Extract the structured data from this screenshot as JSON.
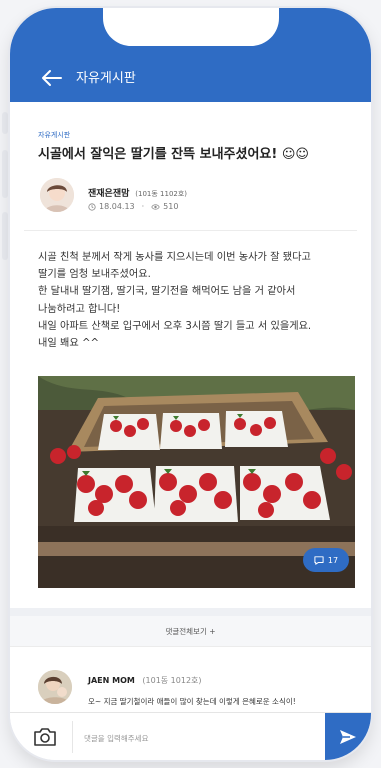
{
  "header": {
    "title": "자유게시판"
  },
  "post": {
    "category": "자유게시판",
    "title": "시골에서 잘익은 딸기를 잔뜩 보내주셨어요! ☺☺",
    "author": {
      "name": "잰재은잰맘",
      "unit": "(101동 1102호)"
    },
    "date": "18.04.13",
    "views": "510",
    "body": "시골 친척 분께서 작게 농사를 지으시는데 이번 농사가 잘 됐다고\n딸기를 엄청 보내주셨어요.\n한 달내내 딸기잼, 딸기국, 딸기전을 해먹어도 남을 거 같아서\n나눔하려고 합니다!\n내일 아파트 산책로 입구에서 오후 3시쯤 딸기 들고 서 있을게요.\n내일 봬요 ^^",
    "comment_count": "17"
  },
  "comments": {
    "view_all": "댓글전체보기 +",
    "first": {
      "author": "JAEN MOM",
      "unit": "(101동 1012호)",
      "text": "오~ 지금 딸기철이라 애들이 많이 찾는데 이렇게 은혜로운 소식이!"
    }
  },
  "input": {
    "placeholder": "댓글을 입력해주세요"
  },
  "colors": {
    "accent": "#2f6cc4"
  }
}
